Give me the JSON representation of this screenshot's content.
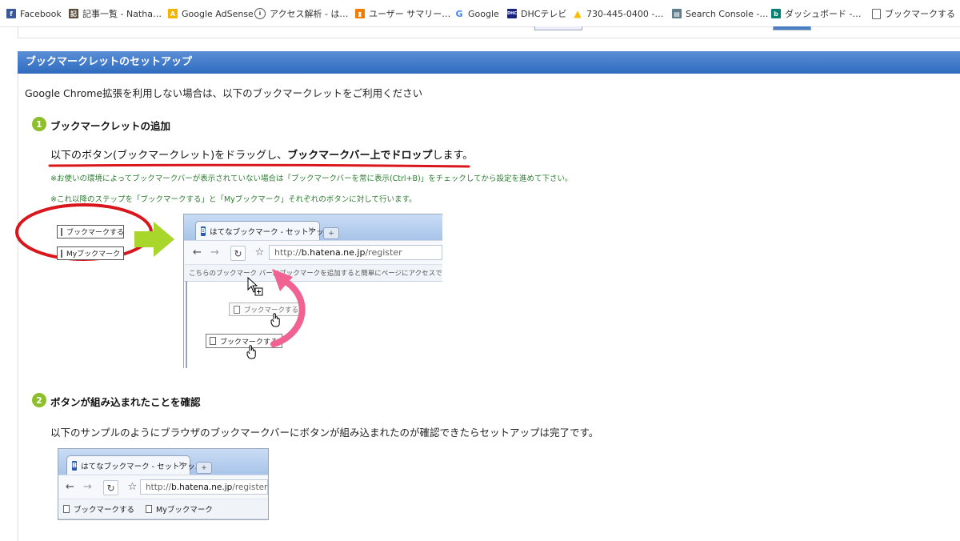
{
  "bookmarks_bar": [
    {
      "label": "Facebook",
      "icon": "facebook-icon",
      "color": "#3b5998"
    },
    {
      "label": "記事一覧 - Natha…",
      "icon": "blog-icon",
      "color": "#5a4a3a"
    },
    {
      "label": "Google AdSense",
      "icon": "adsense-icon",
      "color": "#f4b400"
    },
    {
      "label": "アクセス解析 - は…",
      "icon": "info-icon",
      "color": "#555555"
    },
    {
      "label": "ユーザー サマリー…",
      "icon": "analytics-icon",
      "color": "#f57c00"
    },
    {
      "label": "Google",
      "icon": "google-icon",
      "color": "#4285f4"
    },
    {
      "label": "DHCテレビ",
      "icon": "dhc-icon",
      "color": "#1a237e"
    },
    {
      "label": "730-445-0400 -…",
      "icon": "ads-icon",
      "color": "#fbbc04"
    },
    {
      "label": "Search Console -…",
      "icon": "search-console-icon",
      "color": "#607d8b"
    },
    {
      "label": "ダッシュボード -…",
      "icon": "bing-icon",
      "color": "#008373"
    },
    {
      "label": "ブックマークする",
      "icon": "page-icon",
      "color": "#ffffff"
    }
  ],
  "section": {
    "header": "ブックマークレットのセットアップ",
    "intro": "Google Chrome拡張を利用しない場合は、以下のブックマークレットをご利用ください"
  },
  "step1": {
    "number": "1",
    "title": "ブックマークレットの追加",
    "instr_part1": "以下のボタン(ブックマークレット)をドラッグし、",
    "instr_bold": "ブックマークバー上でドロップ",
    "instr_part2": "します。",
    "note1": "※お使いの環境によってブックマークバーが表示されていない場合は「ブックマークバーを常に表示(Ctrl+B)」をチェックしてから設定を進めて下さい。",
    "note2": "※これ以降のステップを「ブックマークする」と「Myブックマーク」それぞれのボタンに対して行います。",
    "btn_bookmark": "ブックマークする",
    "btn_my": "Myブックマーク"
  },
  "illustration1": {
    "tab_title": "はてなブックマーク - セットアッ...",
    "tab_close": "×",
    "new_tab": "+",
    "url_prefix": "http://",
    "url_host": "b.hatena.ne.jp",
    "url_path": "/register",
    "bm_bar_hint": "こちらのブックマーク バーにブックマークを追加すると簡単にページにアクセスできます。",
    "ghost_label": "ブックマークする",
    "drag_label": "ブックマークする"
  },
  "step2": {
    "number": "2",
    "title": "ボタンが組み込まれたことを確認",
    "text": "以下のサンプルのようにブラウザのブックマークバーにボタンが組み込まれたのが確認できたらセットアップは完了です。"
  },
  "illustration2": {
    "tab_title": "はてなブックマーク - セットアッ...",
    "tab_close": "×",
    "new_tab": "+",
    "url_prefix": "http://",
    "url_host": "b.hatena.ne.jp",
    "url_path": "/register",
    "bm1": "ブックマークする",
    "bm2": "Myブックマーク"
  },
  "colors": {
    "header_blue": "#2f6bbf",
    "step_green": "#8cbf2a",
    "note_green": "#2e7d32",
    "annotation_red": "#d9161c",
    "arrow_green": "#a8d62a",
    "arrow_pink": "#f06292"
  }
}
